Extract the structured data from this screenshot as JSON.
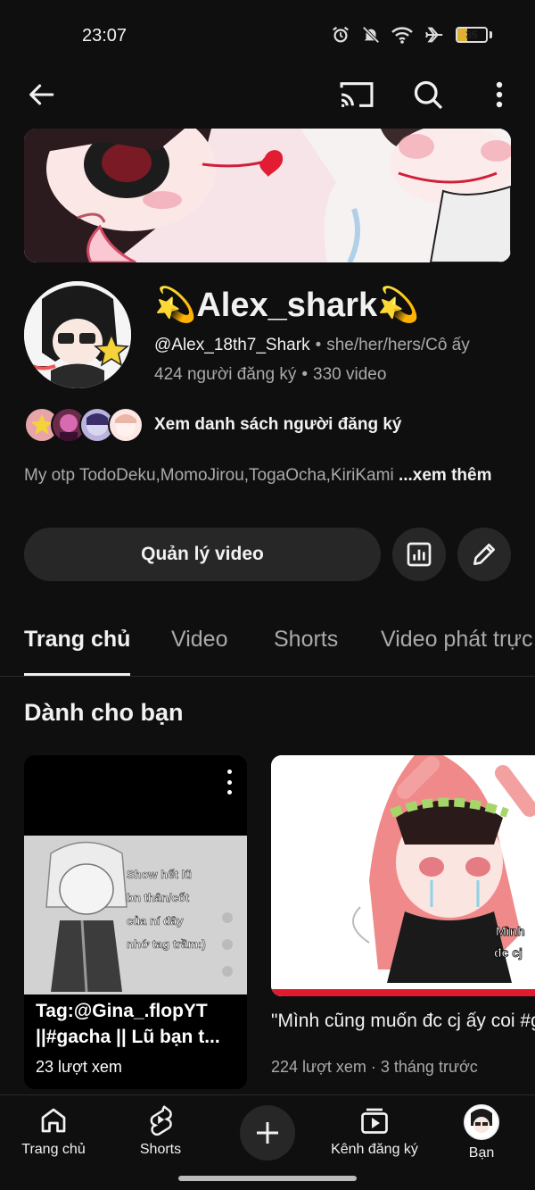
{
  "status_bar": {
    "time": "23:07",
    "battery": "35",
    "battery_level": 0.35
  },
  "top_bar": {
    "back_icon": "arrow-left-icon",
    "cast_icon": "cast-icon",
    "search_icon": "search-icon",
    "more_icon": "more-vertical-icon"
  },
  "channel": {
    "name": "💫Alex_shark💫",
    "handle": "@Alex_18th7_Shark",
    "pronouns": "she/her/hers/Cô ấy",
    "subscribers": "424 người đăng ký",
    "videos": "330 video",
    "subscribers_link": "Xem danh sách người đăng ký",
    "description": "My otp TodoDeku,MomoJirou,TogaOcha,KiriKami",
    "more": "...xem thêm"
  },
  "actions": {
    "manage_videos": "Quản lý video",
    "analytics_icon": "analytics-icon",
    "edit_icon": "pencil-icon"
  },
  "tabs": [
    {
      "label": "Trang chủ",
      "active": true
    },
    {
      "label": "Video",
      "active": false
    },
    {
      "label": "Shorts",
      "active": false
    },
    {
      "label": "Video phát trực tiếp",
      "active": false
    }
  ],
  "section": {
    "title": "Dành cho bạn"
  },
  "videos": [
    {
      "title": "Tag:@Gina_.flopYT ||#gacha || Lũ bạn t...",
      "views": "23 lượt xem",
      "thumb_text": [
        "Show hết lũ",
        "bn thân/cốt",
        "của ní đây",
        "nhớ tag trầm:)"
      ]
    },
    {
      "title": "\"Mình cũng muốn đc cj ấy coi #gacha #capcut #edit #buacte",
      "meta": "224 lượt xem · 3 tháng trước",
      "thumb_text": [
        "Mình",
        "đc cj"
      ]
    }
  ],
  "bottom_nav": [
    {
      "label": "Trang chủ",
      "icon": "home-icon"
    },
    {
      "label": "Shorts",
      "icon": "shorts-icon"
    },
    {
      "label": "",
      "icon": "plus-icon"
    },
    {
      "label": "Kênh đăng ký",
      "icon": "subscriptions-icon"
    },
    {
      "label": "Bạn",
      "icon": "profile-avatar-icon"
    }
  ]
}
